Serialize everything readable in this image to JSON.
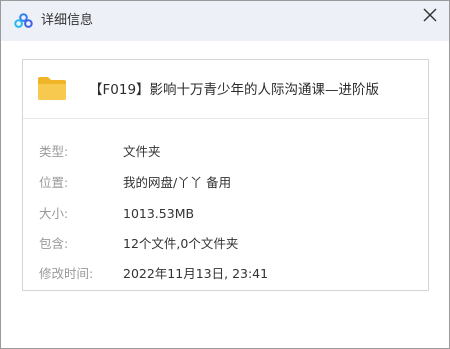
{
  "window": {
    "title": "详细信息",
    "app_icon": "baidu-netdisk-cloud-icon",
    "close_icon": "close-x-icon"
  },
  "file": {
    "icon": "folder-icon",
    "icon_color": "#f6c64a",
    "name": "【F019】影响十万青少年的人际沟通课—进阶版"
  },
  "properties": [
    {
      "label": "类型:",
      "value": "文件夹"
    },
    {
      "label": "位置:",
      "value": "我的网盘/丫丫 备用"
    },
    {
      "label": "大小:",
      "value": "1013.53MB"
    },
    {
      "label": "包含:",
      "value": "12个文件,0个文件夹"
    },
    {
      "label": "修改时间:",
      "value": "2022年11月13日, 23:41"
    }
  ]
}
